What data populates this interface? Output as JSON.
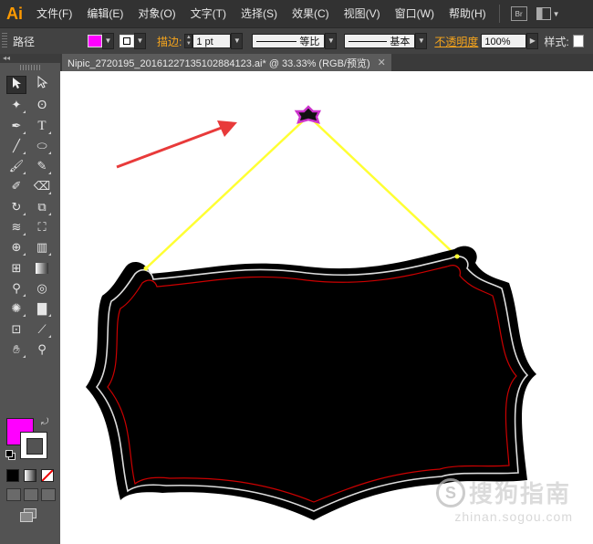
{
  "app": {
    "logo": "Ai"
  },
  "menu": [
    "文件(F)",
    "编辑(E)",
    "对象(O)",
    "文字(T)",
    "选择(S)",
    "效果(C)",
    "视图(V)",
    "窗口(W)",
    "帮助(H)"
  ],
  "menubar_icons": [
    "bridge-icon",
    "workspace-layout-icon"
  ],
  "control": {
    "selection_label": "路径",
    "fill_color": "#ff00ff",
    "stroke_label": "描边:",
    "stroke_weight": "1 pt",
    "profile_label": "等比",
    "brush_label": "基本",
    "opacity_label": "不透明度",
    "opacity_value": "100%",
    "style_label": "样式:"
  },
  "document": {
    "tab_title": "Nipic_2720195_20161227135102884123.ai*  @  33.33%  (RGB/预览)",
    "close_glyph": "✕"
  },
  "toolbox": {
    "header": "◂◂",
    "fill_color": "#ff00ff",
    "stroke_color": "#ffffff"
  },
  "artwork": {
    "sign_fill": "#000000",
    "inner_line_color": "#cc0000",
    "outline_color": "#dddddd",
    "string_color": "#ffff33",
    "hook_color": "#cc33cc",
    "arrow_color": "#e83a3a"
  },
  "watermark": {
    "mark": "S",
    "text": "搜狗指南",
    "url": "zhinan.sogou.com"
  }
}
